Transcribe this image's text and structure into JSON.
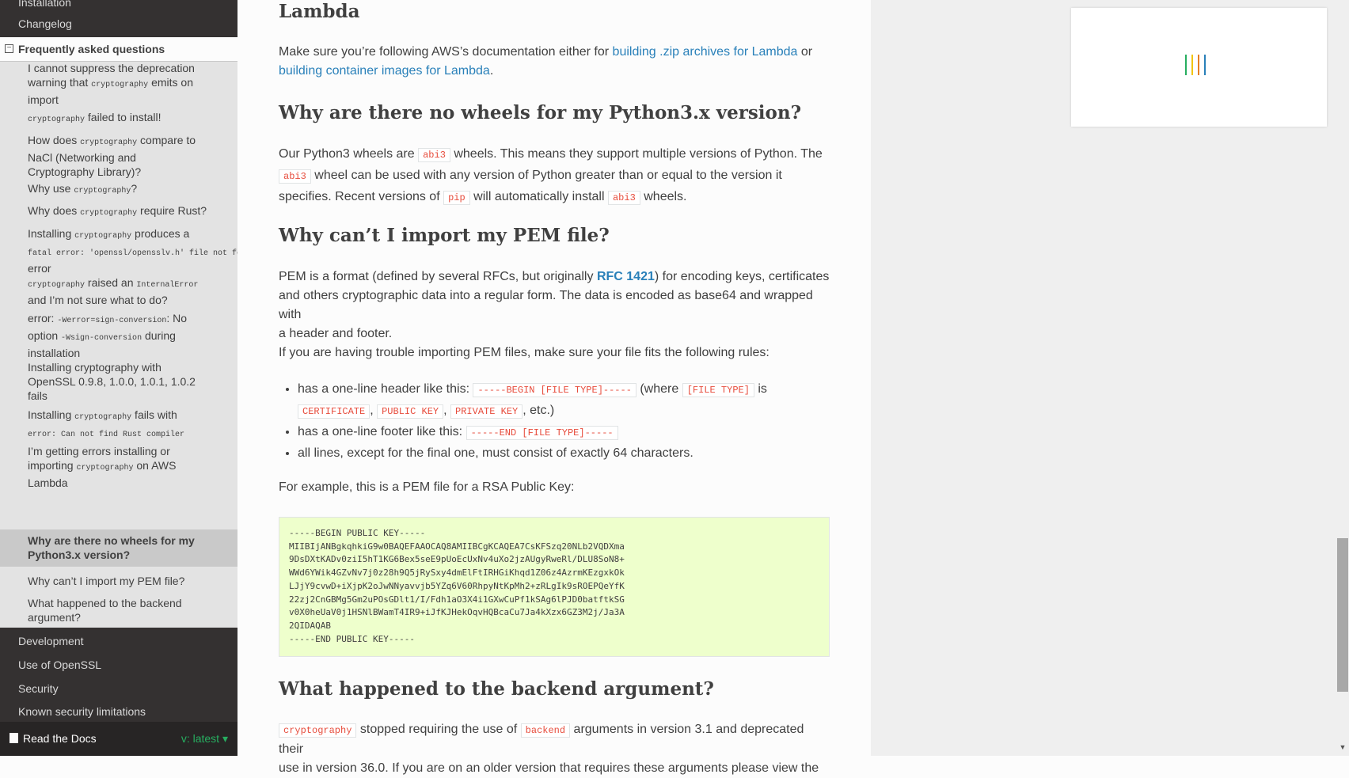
{
  "sidebar": {
    "top_items": [
      "Installation",
      "Changelog"
    ],
    "faq_header": "Frequently asked questions",
    "faq_items": {
      "i0_a": "I cannot suppress the deprecation",
      "i0_b": "warning that ",
      "i0_code": "cryptography",
      "i0_c": " emits on",
      "i0_d": "import",
      "i1_code": "cryptography",
      "i1_a": " failed to install!",
      "i2_a": "How does ",
      "i2_code": "cryptography",
      "i2_b": " compare to",
      "i2_c": "NaCl (Networking and",
      "i2_d": "Cryptography Library)?",
      "i3_a": "Why use ",
      "i3_code": "cryptography",
      "i3_b": "?",
      "i4_a": "Why does ",
      "i4_code": "cryptography",
      "i4_b": " require Rust?",
      "i5_a": "Installing ",
      "i5_code": "cryptography",
      "i5_b": " produces a",
      "i5_code2": "fatal error: 'openssl/opensslv.h' file not found",
      "i5_c": "error",
      "i6_code": "cryptography",
      "i6_a": " raised an ",
      "i6_code2": "InternalError",
      "i6_b": "and I’m not sure what to do?",
      "i7_a": "error: ",
      "i7_code": "-Werror=sign-conversion",
      "i7_b": ": No",
      "i7_c": "option ",
      "i7_code2": "-Wsign-conversion",
      "i7_d": " during",
      "i7_e": "installation",
      "i8_a": "Installing cryptography with",
      "i8_b": "OpenSSL 0.9.8, 1.0.0, 1.0.1, 1.0.2",
      "i8_c": "fails",
      "i9_a": "Installing ",
      "i9_code": "cryptography",
      "i9_b": " fails with",
      "i9_code2": "error: Can not find Rust compiler",
      "i10_a": "I’m getting errors installing or",
      "i10_b": "importing ",
      "i10_code": "cryptography",
      "i10_c": " on AWS",
      "i10_d": "Lambda",
      "i11_a": "Why are there no wheels for my",
      "i11_b": "Python3.x version?",
      "i12_a": "Why can’t I import my PEM file?",
      "i13_a": "What happened to the backend",
      "i13_b": "argument?"
    },
    "bottom_items": [
      "Development",
      "Use of OpenSSL",
      "Security",
      "Known security limitations"
    ],
    "rtd_label": "Read the Docs",
    "version": "v: latest"
  },
  "content": {
    "lambda_heading": "Lambda",
    "lambda_p1": "Make sure you’re following AWS’s documentation either for ",
    "lambda_link1": "building .zip archives for Lambda",
    "lambda_p2": " or",
    "lambda_link2": "building container images for Lambda",
    "lambda_p3": ".",
    "wheels_heading": "Why are there no wheels for my Python3.x version?",
    "wheels_a": "Our Python3 wheels are ",
    "abi3": "abi3",
    "wheels_b": " wheels. This means they support multiple versions of Python. The",
    "wheels_c": " wheel can be used with any version of Python greater than or equal to the version it",
    "wheels_d": "specifies. Recent versions of ",
    "pip": "pip",
    "wheels_e": " will automatically install ",
    "wheels_f": " wheels.",
    "pem_heading": "Why can’t I import my PEM file?",
    "pem_a": "PEM is a format (defined by several RFCs, but originally ",
    "rfc_link": "RFC 1421",
    "pem_b": ") for encoding keys, certificates",
    "pem_c": "and others cryptographic data into a regular form. The data is encoded as base64 and wrapped with",
    "pem_d": "a header and footer.",
    "trouble": "If you are having trouble importing PEM files, make sure your file fits the following rules:",
    "rule1_a": "has a one-line header like this: ",
    "rule1_code": "-----BEGIN [FILE TYPE]-----",
    "rule1_b": " (where ",
    "rule1_code2": "[FILE TYPE]",
    "rule1_c": " is",
    "rule1_code3": "CERTIFICATE",
    "rule1_d": ", ",
    "rule1_code4": "PUBLIC KEY",
    "rule1_e": ", ",
    "rule1_code5": "PRIVATE KEY",
    "rule1_f": ", etc.)",
    "rule2_a": "has a one-line footer like this: ",
    "rule2_code": "-----END [FILE TYPE]-----",
    "rule3": "all lines, except for the final one, must consist of exactly 64 characters.",
    "example": "For example, this is a PEM file for a RSA Public Key:",
    "pem_block": "-----BEGIN PUBLIC KEY-----\nMIIBIjANBgkqhkiG9w0BAQEFAAOCAQ8AMIIBCgKCAQEA7CsKFSzq20NLb2VQDXma\n9DsDXtKADv0ziI5hT1KG6Bex5seE9pUoEcUxNv4uXo2jzAUgyRweRl/DLU8SoN8+\nWWd6YWik4GZvNv7j0z28h9Q5jRySxy4dmElFtIRHGiKhqd1Z06z4AzrmKEzgxkOk\nLJjY9cvwD+iXjpK2oJwNNyavvjb5YZq6V60RhpyNtKpMh2+zRLgIk9sROEPQeYfK\n22zj2CnGBMg5Gm2uPOsGDlt1/I/Fdh1aO3X4i1GXwCuPf1kSAg6lPJD0batftkSG\nv0X0heUaV0j1HSNlBWamT4IR9+iJfKJHekOqvHQBcaCu7Ja4kXzx6GZ3M2j/Ja3A\n2QIDAQAB\n-----END PUBLIC KEY-----",
    "backend_heading": "What happened to the backend argument?",
    "backend_code": "cryptography",
    "backend_a": " stopped requiring the use of ",
    "backend_code2": "backend",
    "backend_b": " arguments in version 3.1 and deprecated their",
    "backend_c": "use in version 36.0. If you are on an older version that requires these arguments please view the"
  },
  "colors": {
    "sidebar_bg": "#343131",
    "link": "#2980b9",
    "literal": "#e74c3c",
    "code_block_bg": "#eeffcc",
    "spinner": [
      "#27ae60",
      "#f1c40f",
      "#e67e22",
      "#2980b9"
    ]
  }
}
